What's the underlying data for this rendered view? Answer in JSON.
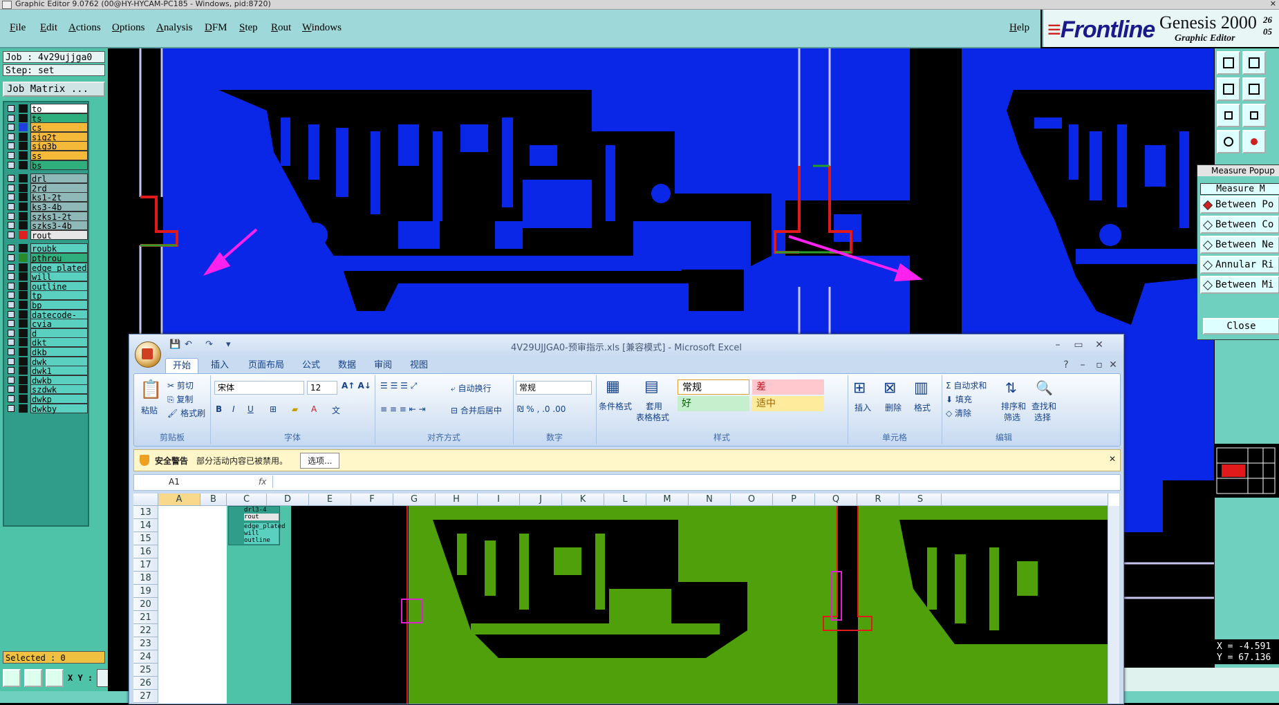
{
  "genesis": {
    "title": "Graphic Editor 9.0762 (00@HY-HYCAM-PC185 - Windows, pid:8720)",
    "menu": [
      "File",
      "Edit",
      "Actions",
      "Options",
      "Analysis",
      "DFM",
      "Step",
      "Rout",
      "Windows"
    ],
    "help": "Help",
    "brand": {
      "logo": "Frontline",
      "product": "Genesis 2000",
      "subtitle": "Graphic Editor",
      "nums_top": "26",
      "nums_bottom": "05"
    },
    "job": "Job : 4v29ujjga0",
    "step": "Step: set",
    "job_matrix": "Job Matrix ...",
    "layers": [
      {
        "name": "to",
        "bg": "#ffffff",
        "swatch": "#111111"
      },
      {
        "name": "ts",
        "bg": "#2fae7e",
        "swatch": "#111111"
      },
      {
        "name": "cs",
        "bg": "#f5b93a",
        "swatch": "#1f3fe0"
      },
      {
        "name": "sig2t",
        "bg": "#f5b93a",
        "swatch": "#111111"
      },
      {
        "name": "sig3b",
        "bg": "#f5b93a",
        "swatch": "#111111"
      },
      {
        "name": "ss",
        "bg": "#f5b93a",
        "swatch": "#111111"
      },
      {
        "name": "bs",
        "bg": "#2fae7e",
        "swatch": "#111111"
      },
      {
        "name": "drl",
        "bg": "#8fb8b8",
        "swatch": "#111111"
      },
      {
        "name": "2rd",
        "bg": "#8fb8b8",
        "swatch": "#111111"
      },
      {
        "name": "ks1-2t",
        "bg": "#8fb8b8",
        "swatch": "#111111"
      },
      {
        "name": "ks3-4b",
        "bg": "#8fb8b8",
        "swatch": "#111111"
      },
      {
        "name": "szks1-2t",
        "bg": "#8fb8b8",
        "swatch": "#111111"
      },
      {
        "name": "szks3-4b",
        "bg": "#8fb8b8",
        "swatch": "#111111"
      },
      {
        "name": "rout",
        "bg": "#e6e6e6",
        "swatch": "#e02020"
      },
      {
        "name": "roubk",
        "bg": "#5ad0c0",
        "swatch": "#111111"
      },
      {
        "name": "pthrou",
        "bg": "#2fae7e",
        "swatch": "#2a8a2a"
      },
      {
        "name": "edge_plated",
        "bg": "#5ad0c0",
        "swatch": "#111111"
      },
      {
        "name": "will",
        "bg": "#5ad0c0",
        "swatch": "#111111"
      },
      {
        "name": "outline",
        "bg": "#5ad0c0",
        "swatch": "#111111"
      },
      {
        "name": "tp",
        "bg": "#5ad0c0",
        "swatch": "#111111"
      },
      {
        "name": "bp",
        "bg": "#5ad0c0",
        "swatch": "#111111"
      },
      {
        "name": "datecode-pto",
        "bg": "#5ad0c0",
        "swatch": "#111111"
      },
      {
        "name": "cvia",
        "bg": "#5ad0c0",
        "swatch": "#111111"
      },
      {
        "name": "d",
        "bg": "#5ad0c0",
        "swatch": "#111111"
      },
      {
        "name": "dkt",
        "bg": "#5ad0c0",
        "swatch": "#111111"
      },
      {
        "name": "dkb",
        "bg": "#5ad0c0",
        "swatch": "#111111"
      },
      {
        "name": "dwk",
        "bg": "#5ad0c0",
        "swatch": "#111111"
      },
      {
        "name": "dwk1",
        "bg": "#5ad0c0",
        "swatch": "#111111"
      },
      {
        "name": "dwkb",
        "bg": "#5ad0c0",
        "swatch": "#111111"
      },
      {
        "name": "szdwk",
        "bg": "#5ad0c0",
        "swatch": "#111111"
      },
      {
        "name": "dwkp",
        "bg": "#5ad0c0",
        "swatch": "#111111"
      },
      {
        "name": "dwkby",
        "bg": "#5ad0c0",
        "swatch": "#111111"
      }
    ],
    "selected": "Selected : 0",
    "xy_label": "X Y :",
    "measure": {
      "title": "Measure Popup",
      "header": "Measure M",
      "options": [
        "Between Po",
        "Between Co",
        "Between Ne",
        "Annular Ri",
        "Between Mi"
      ],
      "close": "Close"
    },
    "coords": {
      "x": "X = -4.591",
      "y": "Y = 67.136"
    },
    "colors": {
      "copper": "#0a26e6",
      "green": "#4fa00a",
      "rout": "#e01a1a",
      "arrow": "#ff22ee"
    }
  },
  "excel": {
    "title": "4V29UJJGA0-预审指示.xls  [兼容模式] - Microsoft Excel",
    "tabs": [
      "开始",
      "插入",
      "页面布局",
      "公式",
      "数据",
      "审阅",
      "视图"
    ],
    "clipboard": {
      "paste": "粘贴",
      "cut": "剪切",
      "copy": "复制",
      "format_painter": "格式刷",
      "label": "剪贴板"
    },
    "font": {
      "name": "宋体",
      "size": "12",
      "label": "字体"
    },
    "align": {
      "wrap": "自动换行",
      "merge": "合并后居中",
      "label": "对齐方式"
    },
    "number": {
      "format": "常规",
      "label": "数字"
    },
    "styles": {
      "cond": "条件格式",
      "table1": "套用",
      "table2": "表格格式",
      "normal": "常规",
      "bad": "差",
      "good": "好",
      "neutral": "适中",
      "label": "样式"
    },
    "cells": {
      "insert": "插入",
      "delete": "删除",
      "format": "格式",
      "label": "单元格"
    },
    "edit": {
      "autosum": "自动求和",
      "fill": "填充",
      "clear": "清除",
      "sort1": "排序和",
      "sort2": "筛选",
      "find1": "查找和",
      "find2": "选择",
      "label": "编辑"
    },
    "warning": {
      "title": "安全警告",
      "text": "部分活动内容已被禁用。",
      "button": "选项..."
    },
    "namebox": "A1",
    "fx": "fx",
    "columns": [
      "A",
      "B",
      "C",
      "D",
      "E",
      "F",
      "G",
      "H",
      "I",
      "J",
      "K",
      "L",
      "M",
      "N",
      "O",
      "P",
      "Q",
      "R",
      "S"
    ],
    "rows": [
      "13",
      "14",
      "15",
      "16",
      "17",
      "18",
      "19",
      "20",
      "21",
      "22",
      "23",
      "24",
      "25",
      "26",
      "27"
    ],
    "embedded_layers": [
      "drl3-4",
      "rout",
      "edge_plated",
      "will",
      "outline"
    ]
  }
}
